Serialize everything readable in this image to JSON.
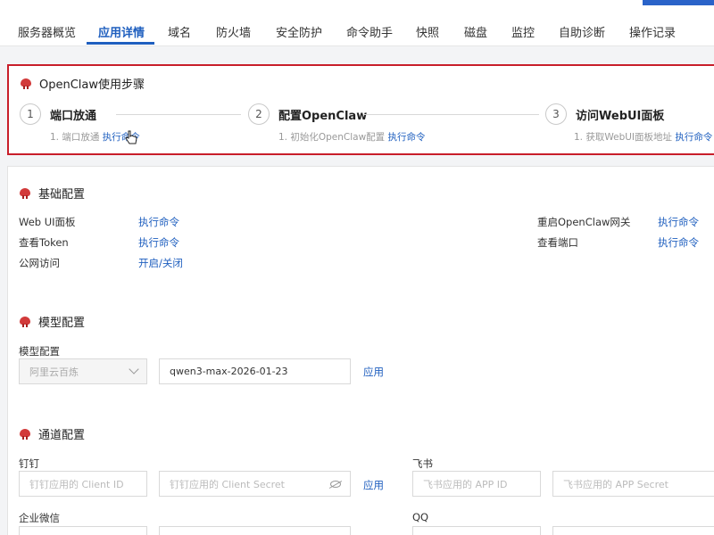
{
  "tabs": [
    "服务器概览",
    "应用详情",
    "域名",
    "防火墙",
    "安全防护",
    "命令助手",
    "快照",
    "磁盘",
    "监控",
    "自助诊断",
    "操作记录"
  ],
  "active_tab": "应用详情",
  "steps_panel": {
    "title": "OpenClaw使用步骤",
    "steps": [
      {
        "num": "1",
        "name": "端口放通",
        "sub": "1. 端口放通",
        "action": "执行命令"
      },
      {
        "num": "2",
        "name": "配置OpenClaw",
        "sub": "1. 初始化OpenClaw配置",
        "action": "执行命令"
      },
      {
        "num": "3",
        "name": "访问WebUI面板",
        "sub": "1. 获取WebUI面板地址",
        "action": "执行命令"
      }
    ]
  },
  "basic": {
    "title": "基础配置",
    "left_rows": [
      {
        "label": "Web UI面板",
        "action": "执行命令"
      },
      {
        "label": "查看Token",
        "action": "执行命令"
      },
      {
        "label": "公网访问",
        "action": "开启/关闭"
      }
    ],
    "right_rows": [
      {
        "label": "重启OpenClaw网关",
        "action": "执行命令"
      },
      {
        "label": "查看端口",
        "action": "执行命令"
      }
    ]
  },
  "model": {
    "title": "模型配置",
    "label": "模型配置",
    "provider_value": "阿里云百炼",
    "model_value": "qwen3-max-2026-01-23",
    "apply": "应用"
  },
  "channel": {
    "title": "通道配置",
    "dingtalk": {
      "label": "钉钉",
      "client_id_placeholder": "钉钉应用的 Client ID",
      "client_secret_placeholder": "钉钉应用的 Client Secret",
      "apply": "应用"
    },
    "feishu": {
      "label": "飞书",
      "app_id_placeholder": "飞书应用的 APP ID",
      "app_secret_placeholder": "飞书应用的 APP Secret"
    },
    "wecom": {
      "label": "企业微信"
    },
    "qq": {
      "label": "QQ"
    }
  },
  "colors": {
    "accent": "#1f5fbf",
    "highlight_border": "#c81e2a",
    "logo": "#d23a3a"
  }
}
